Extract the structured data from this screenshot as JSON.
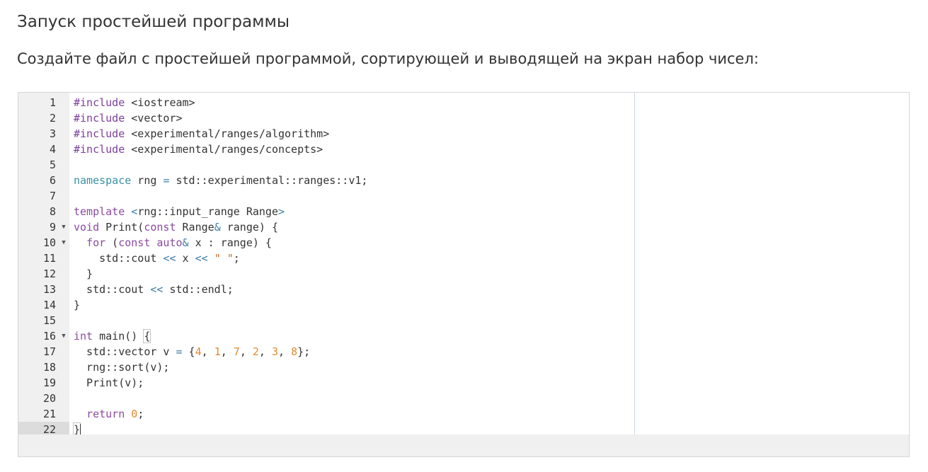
{
  "page": {
    "title": "Запуск простейшей программы",
    "description": "Создайте файл с простейшей программой, сортирующей и выводящей на экран набор чисел:"
  },
  "editor": {
    "language": "cpp",
    "active_line": 22,
    "colors": {
      "preprocessor": "#7a3e9d",
      "keyword": "#8a4ba0",
      "namespace_keyword": "#3a8fa3",
      "operator": "#3c7ca8",
      "number": "#e08c2e",
      "string": "#c46d28",
      "text": "#333333",
      "gutter_bg": "#f0f0f0",
      "print_margin": "#c8d3e6"
    },
    "lines": [
      {
        "num": "1",
        "fold": false,
        "tokens": [
          {
            "t": "#include",
            "c": "pp"
          },
          {
            "t": " <iostream>",
            "c": ""
          }
        ]
      },
      {
        "num": "2",
        "fold": false,
        "tokens": [
          {
            "t": "#include",
            "c": "pp"
          },
          {
            "t": " <vector>",
            "c": ""
          }
        ]
      },
      {
        "num": "3",
        "fold": false,
        "tokens": [
          {
            "t": "#include",
            "c": "pp"
          },
          {
            "t": " <experimental/ranges/algorithm>",
            "c": ""
          }
        ]
      },
      {
        "num": "4",
        "fold": false,
        "tokens": [
          {
            "t": "#include",
            "c": "pp"
          },
          {
            "t": " <experimental/ranges/concepts>",
            "c": ""
          }
        ]
      },
      {
        "num": "5",
        "fold": false,
        "tokens": []
      },
      {
        "num": "6",
        "fold": false,
        "tokens": [
          {
            "t": "namespace",
            "c": "ns"
          },
          {
            "t": " rng ",
            "c": ""
          },
          {
            "t": "=",
            "c": "op"
          },
          {
            "t": " std::experimental::ranges::v1;",
            "c": ""
          }
        ]
      },
      {
        "num": "7",
        "fold": false,
        "tokens": []
      },
      {
        "num": "8",
        "fold": false,
        "tokens": [
          {
            "t": "template",
            "c": "kw"
          },
          {
            "t": " ",
            "c": ""
          },
          {
            "t": "<",
            "c": "op"
          },
          {
            "t": "rng::input_range Range",
            "c": ""
          },
          {
            "t": ">",
            "c": "op"
          }
        ]
      },
      {
        "num": "9",
        "fold": true,
        "tokens": [
          {
            "t": "void",
            "c": "kw"
          },
          {
            "t": " Print(",
            "c": ""
          },
          {
            "t": "const",
            "c": "kw"
          },
          {
            "t": " Range",
            "c": ""
          },
          {
            "t": "&",
            "c": "op"
          },
          {
            "t": " range) {",
            "c": ""
          }
        ]
      },
      {
        "num": "10",
        "fold": true,
        "tokens": [
          {
            "t": "  ",
            "c": ""
          },
          {
            "t": "for",
            "c": "kw"
          },
          {
            "t": " (",
            "c": ""
          },
          {
            "t": "const",
            "c": "kw"
          },
          {
            "t": " ",
            "c": ""
          },
          {
            "t": "auto",
            "c": "kw"
          },
          {
            "t": "&",
            "c": "op"
          },
          {
            "t": " x : range) {",
            "c": ""
          }
        ]
      },
      {
        "num": "11",
        "fold": false,
        "tokens": [
          {
            "t": "    std::cout ",
            "c": ""
          },
          {
            "t": "<<",
            "c": "op"
          },
          {
            "t": " x ",
            "c": ""
          },
          {
            "t": "<<",
            "c": "op"
          },
          {
            "t": " ",
            "c": ""
          },
          {
            "t": "\" \"",
            "c": "str"
          },
          {
            "t": ";",
            "c": ""
          }
        ]
      },
      {
        "num": "12",
        "fold": false,
        "tokens": [
          {
            "t": "  }",
            "c": ""
          }
        ]
      },
      {
        "num": "13",
        "fold": false,
        "tokens": [
          {
            "t": "  std::cout ",
            "c": ""
          },
          {
            "t": "<<",
            "c": "op"
          },
          {
            "t": " std::endl;",
            "c": ""
          }
        ]
      },
      {
        "num": "14",
        "fold": false,
        "tokens": [
          {
            "t": "}",
            "c": ""
          }
        ]
      },
      {
        "num": "15",
        "fold": false,
        "tokens": []
      },
      {
        "num": "16",
        "fold": true,
        "tokens": [
          {
            "t": "int",
            "c": "kw"
          },
          {
            "t": " main() ",
            "c": ""
          },
          {
            "t": "{",
            "c": "br"
          }
        ]
      },
      {
        "num": "17",
        "fold": false,
        "tokens": [
          {
            "t": "  std::vector v ",
            "c": ""
          },
          {
            "t": "=",
            "c": "op"
          },
          {
            "t": " {",
            "c": ""
          },
          {
            "t": "4",
            "c": "num"
          },
          {
            "t": ", ",
            "c": ""
          },
          {
            "t": "1",
            "c": "num"
          },
          {
            "t": ", ",
            "c": ""
          },
          {
            "t": "7",
            "c": "num"
          },
          {
            "t": ", ",
            "c": ""
          },
          {
            "t": "2",
            "c": "num"
          },
          {
            "t": ", ",
            "c": ""
          },
          {
            "t": "3",
            "c": "num"
          },
          {
            "t": ", ",
            "c": ""
          },
          {
            "t": "8",
            "c": "num"
          },
          {
            "t": "};",
            "c": ""
          }
        ]
      },
      {
        "num": "18",
        "fold": false,
        "tokens": [
          {
            "t": "  rng::sort(v);",
            "c": ""
          }
        ]
      },
      {
        "num": "19",
        "fold": false,
        "tokens": [
          {
            "t": "  Print(v);",
            "c": ""
          }
        ]
      },
      {
        "num": "20",
        "fold": false,
        "tokens": []
      },
      {
        "num": "21",
        "fold": false,
        "tokens": [
          {
            "t": "  ",
            "c": ""
          },
          {
            "t": "return",
            "c": "kw"
          },
          {
            "t": " ",
            "c": ""
          },
          {
            "t": "0",
            "c": "num"
          },
          {
            "t": ";",
            "c": ""
          }
        ]
      },
      {
        "num": "22",
        "fold": false,
        "tokens": [
          {
            "t": "}",
            "c": "br"
          }
        ]
      }
    ]
  }
}
